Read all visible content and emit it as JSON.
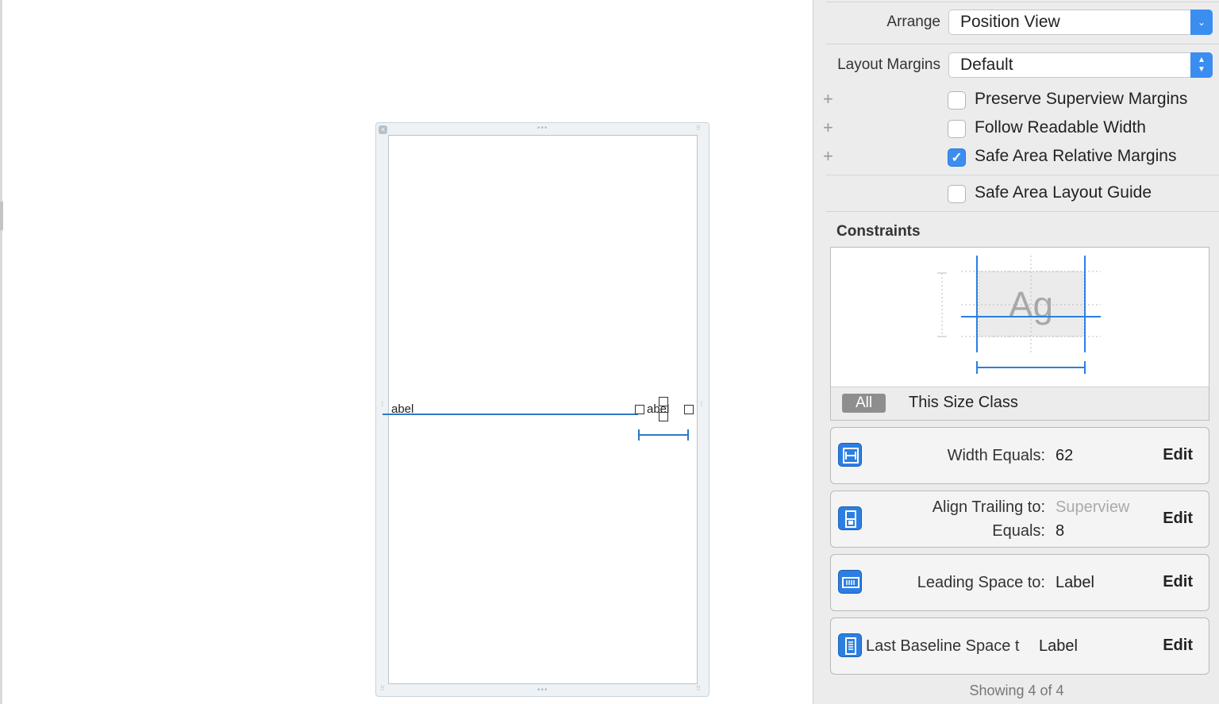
{
  "canvas": {
    "label_left": "abel",
    "label_right": "abel"
  },
  "inspector": {
    "arrange": {
      "label": "Arrange",
      "value": "Position View"
    },
    "layout_margins": {
      "label": "Layout Margins",
      "value": "Default"
    },
    "checkboxes": [
      {
        "label": "Preserve Superview Margins",
        "checked": false
      },
      {
        "label": "Follow Readable Width",
        "checked": false
      },
      {
        "label": "Safe Area Relative Margins",
        "checked": true
      },
      {
        "label": "Safe Area Layout Guide",
        "checked": false
      }
    ],
    "constraints": {
      "heading": "Constraints",
      "preview_text": "Ag",
      "all_chip": "All",
      "size_class": "This Size Class"
    },
    "constraint_list": [
      {
        "icon": "width-constraint-icon",
        "key": "Width Equals:",
        "value": "62",
        "edit": "Edit"
      },
      {
        "icon": "align-trailing-icon",
        "key": "Align Trailing to:",
        "value": "Superview",
        "key2": "Equals:",
        "value2": "8",
        "edit": "Edit"
      },
      {
        "icon": "leading-space-icon",
        "key": "Leading Space to:",
        "value": "Label",
        "edit": "Edit"
      },
      {
        "icon": "baseline-space-icon",
        "key": "Last Baseline Space t",
        "value": "Label",
        "edit": "Edit"
      }
    ],
    "showing": "Showing 4 of 4"
  },
  "colors": {
    "accent": "#3b8df0",
    "constraint_blue": "#2f77c9",
    "inspector_bg": "#ececec"
  }
}
